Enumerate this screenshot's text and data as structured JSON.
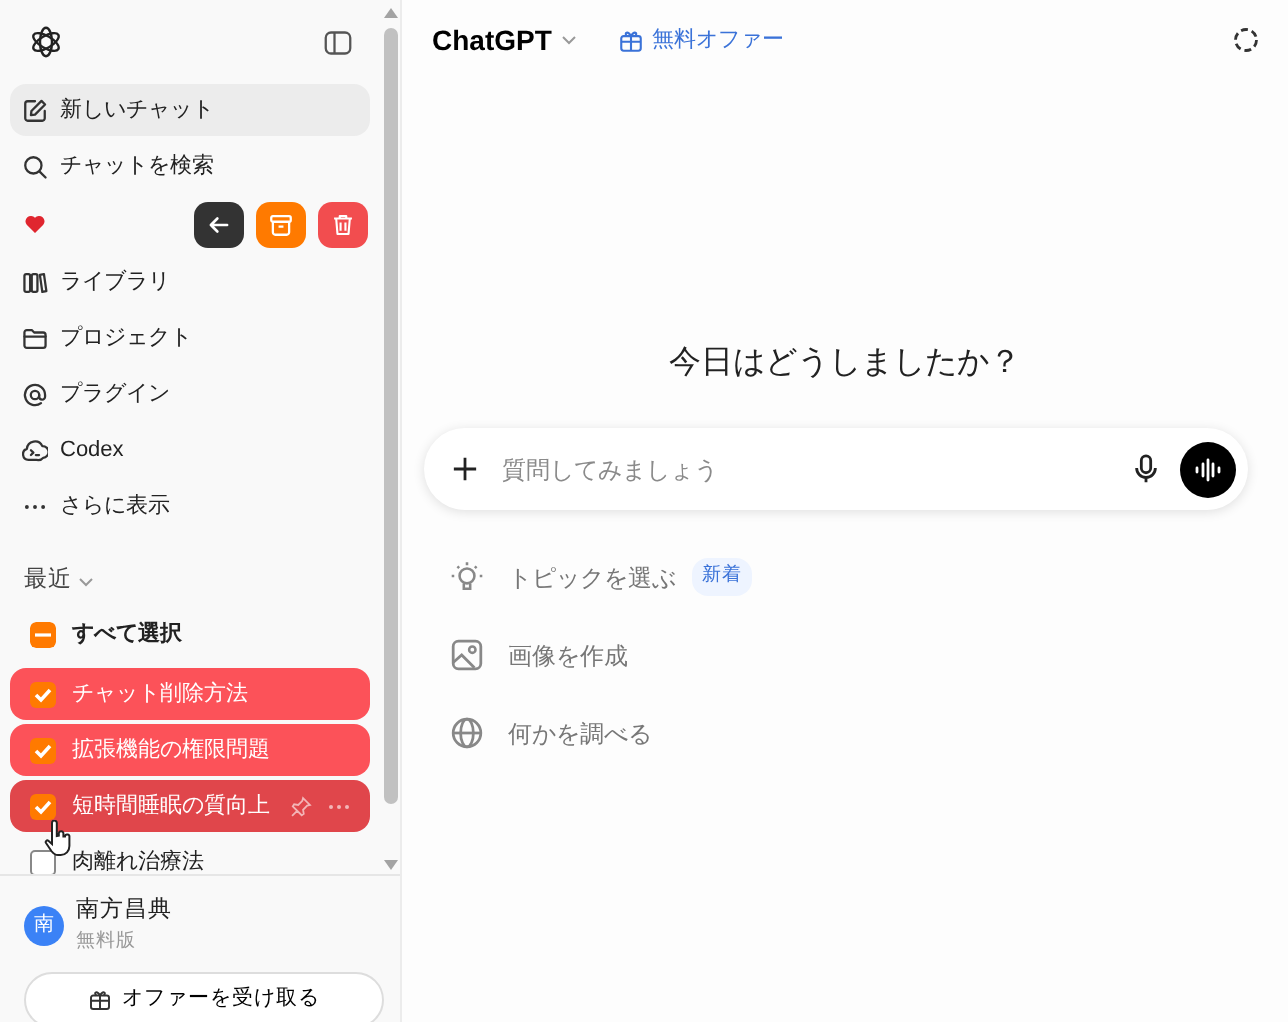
{
  "sidebar": {
    "nav": [
      {
        "kind": "new",
        "label": "新しいチャット",
        "selected": true
      },
      {
        "kind": "search",
        "label": "チャットを検索",
        "selected": false
      }
    ],
    "bulk_actions": [
      {
        "kind": "back",
        "color": "#333333"
      },
      {
        "kind": "archive",
        "color": "#ff7a00"
      },
      {
        "kind": "delete",
        "color": "#f24d4f"
      }
    ],
    "nav2": [
      {
        "kind": "library",
        "label": "ライブラリ",
        "selected": false
      },
      {
        "kind": "project",
        "label": "プロジェクト",
        "selected": false
      },
      {
        "kind": "plugin",
        "label": "プラグイン",
        "selected": false
      },
      {
        "kind": "codex",
        "label": "Codex",
        "selected": false
      },
      {
        "kind": "more",
        "label": "さらに表示",
        "selected": false
      }
    ],
    "recent_heading": "最近",
    "select_all": {
      "label": "すべて選択",
      "indeterminate": true
    },
    "chats": [
      {
        "title": "チャット削除方法",
        "checked": true,
        "hovered": false
      },
      {
        "title": "拡張機能の権限問題",
        "checked": true,
        "hovered": false
      },
      {
        "title": "短時間睡眠の質向上",
        "checked": true,
        "hovered": true
      },
      {
        "title": "肉離れ治療法",
        "checked": false,
        "hovered": false
      }
    ],
    "user": {
      "avatar": "南",
      "name": "南方昌典",
      "plan": "無料版"
    },
    "offer_button": "オファーを受け取る"
  },
  "header": {
    "model": "ChatGPT",
    "offer": "無料オファー"
  },
  "greeting": "今日はどうしましたか？",
  "composer": {
    "placeholder": "質問してみましょう"
  },
  "suggestions": [
    {
      "kind": "topic",
      "label": "トピックを選ぶ",
      "badge": "新着"
    },
    {
      "kind": "image",
      "label": "画像を作成"
    },
    {
      "kind": "web",
      "label": "何かを調べる"
    }
  ]
}
